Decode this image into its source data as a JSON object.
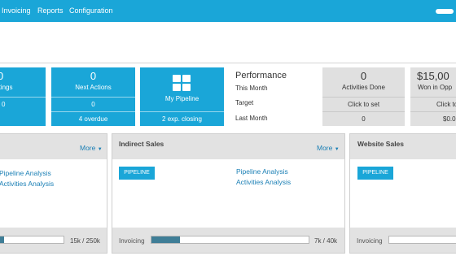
{
  "menu": {
    "items": [
      {
        "label": "Invoicing"
      },
      {
        "label": "Reports"
      },
      {
        "label": "Configuration"
      }
    ]
  },
  "kpis": {
    "meetings": {
      "value": "0",
      "label": "Meetings",
      "sub": "0"
    },
    "next_actions": {
      "value": "0",
      "label": "Next Actions",
      "sub": "0",
      "overdue": "4 overdue"
    },
    "my_pipeline": {
      "label": "My Pipeline",
      "sub": "2 exp. closing",
      "icon": "grid-icon"
    },
    "performance": {
      "title": "Performance",
      "this_month": "This Month",
      "target": "Target",
      "last_month": "Last Month"
    },
    "activities": {
      "value": "0",
      "label": "Activities Done",
      "target": "Click to set",
      "last": "0"
    },
    "won": {
      "value": "$15,00",
      "label": "Won in Opp",
      "target": "Click to",
      "last": "$0.0"
    }
  },
  "panels": [
    {
      "title": "",
      "more": "More",
      "links": [
        "Pipeline Analysis",
        "Activities Analysis"
      ],
      "pipeline_button": "",
      "footer_label": "",
      "footer_value": "15k / 250k",
      "progress": 0.06
    },
    {
      "title": "Indirect Sales",
      "more": "More",
      "links": [
        "Pipeline Analysis",
        "Activities Analysis"
      ],
      "pipeline_button": "PIPELINE",
      "footer_label": "Invoicing",
      "footer_value": "7k / 40k",
      "progress": 0.18
    },
    {
      "title": "Website Sales",
      "more": "",
      "links": [],
      "pipeline_button": "PIPELINE",
      "footer_label": "Invoicing",
      "footer_value": "",
      "progress": 0
    }
  ],
  "colors": {
    "accent": "#1aa6d8",
    "tile_gray": "#e0e0e0",
    "link": "#1a7fb5",
    "progress_fill": "#3f7e97"
  }
}
